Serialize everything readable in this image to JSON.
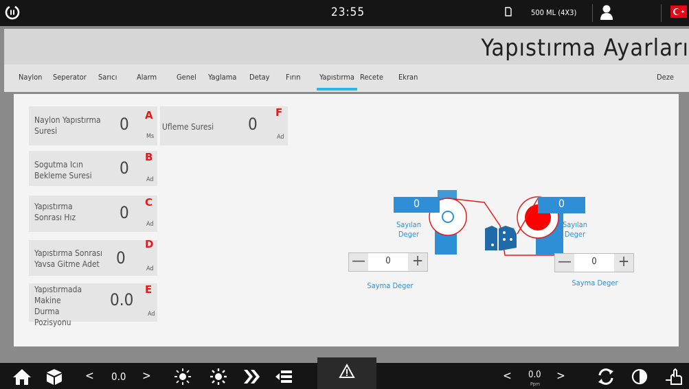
{
  "topbar": {
    "clock": "23:55",
    "recipe": "500 ML (4X3)"
  },
  "header": {
    "title": "Yapıstırma Ayarları"
  },
  "tabs": [
    {
      "label": "Naylon"
    },
    {
      "label": "Seperator"
    },
    {
      "label": "Sarıcı"
    },
    {
      "label": "Alarm"
    },
    {
      "label": "Genel"
    },
    {
      "label": "Yaglama"
    },
    {
      "label": "Detay"
    },
    {
      "label": "Fırın"
    },
    {
      "label": "Yapıstırma"
    },
    {
      "label": "Recete"
    },
    {
      "label": "Ekran"
    },
    {
      "label": "Deze"
    }
  ],
  "active_tab": "Yapıstırma",
  "params": [
    {
      "label": "Naylon Yapıstırma Suresi",
      "value": "0",
      "letter": "A",
      "unit": "Ms"
    },
    {
      "label": "Sogutma Icın Bekleme Suresi",
      "value": "0",
      "letter": "B",
      "unit": "Ad"
    },
    {
      "label": "Yapıstırma Sonrası Hız",
      "value": "0",
      "letter": "C",
      "unit": "Ad"
    },
    {
      "label": "Yapıstırma Sonrası Yavsa Gitme Adet",
      "value": "0",
      "letter": "D",
      "unit": "Ad"
    },
    {
      "label": "Yapıstırmada Makine Durma Pozisyonu",
      "value": "0.0",
      "letter": "E",
      "unit": "Ad"
    },
    {
      "label": "Ufleme Suresi",
      "value": "0",
      "letter": "F",
      "unit": "Ad"
    }
  ],
  "diagram": {
    "left_counter": {
      "value": "0",
      "label": "Sayılan Deger"
    },
    "right_counter": {
      "value": "0",
      "label": "Sayılan Deger"
    },
    "left_stepper": {
      "value": "0",
      "label": "Sayma Deger",
      "minus": "—",
      "plus": "+"
    },
    "right_stepper": {
      "value": "0",
      "label": "Sayma Deger",
      "minus": "—",
      "plus": "+"
    }
  },
  "bottombar": {
    "left_value": "0.0",
    "right_value": "0.0",
    "right_unit": "Ppm",
    "prev": "<",
    "next": ">"
  },
  "colors": {
    "accent": "#29b6e8",
    "blue": "#2e8fd6",
    "red": "#e31b1b",
    "bar": "#151515"
  }
}
